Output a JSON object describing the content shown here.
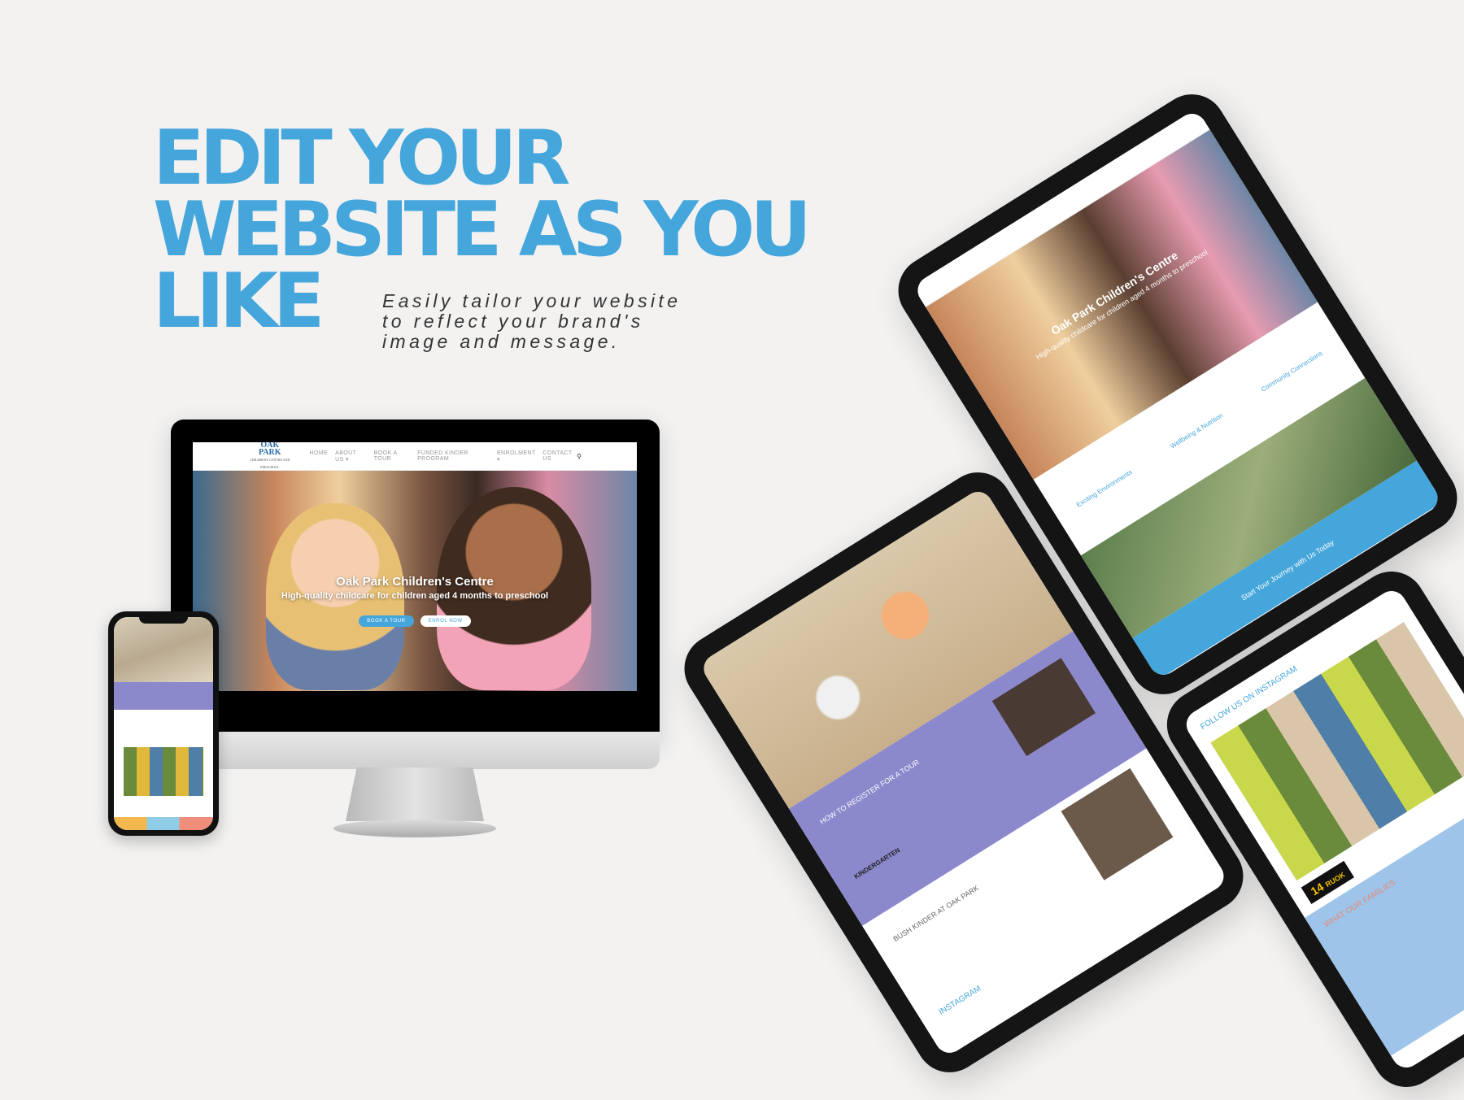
{
  "headline": {
    "line1": "EDIT YOUR",
    "line2": "WEBSITE AS YOU",
    "line3": "LIKE"
  },
  "tagline": {
    "line1": "Easily tailor your website",
    "line2": "to reflect your brand's",
    "line3": "image and message."
  },
  "desktop": {
    "logo": {
      "name": "OAK PARK",
      "sub": "CHILDREN'S CENTRE AND PRESCHOOL"
    },
    "nav": [
      "HOME",
      "ABOUT US ▾",
      "BOOK A TOUR",
      "FUNDED KINDER PROGRAM",
      "ENROLMENT ▾",
      "CONTACT US"
    ],
    "search_icon": "⚲",
    "hero": {
      "title": "Oak Park Children's Centre",
      "subtitle": "High-quality childcare for children aged 4 months to preschool",
      "btn_tour": "BOOK A TOUR",
      "btn_enrol": "ENROL NOW"
    }
  },
  "tablet_right": {
    "hero_title": "Oak Park Children's Centre",
    "hero_subtitle": "High-quality childcare for children aged 4 months to preschool",
    "features": [
      "Exciting Environments",
      "Wellbeing & Nutrition",
      "Community Connections"
    ],
    "cta": "Start Your Journey with Us Today"
  },
  "tablet_middle": {
    "tour_heading": "HOW TO REGISTER FOR A TOUR",
    "kinder_label": "KINDERGARTEN",
    "bush_heading": "BUSH KINDER AT OAK PARK",
    "insta_heading": "INSTAGRAM"
  },
  "tablet_bottom_right": {
    "follow_heading": "FOLLOW US ON INSTAGRAM",
    "families_heading": "WHAT OUR FAMILIES",
    "badge_number": "14",
    "badge_sub": "RUOK"
  },
  "colors": {
    "brand_blue": "#45a6dc",
    "lavender": "#8b88cc",
    "tablet_frame": "#151515"
  }
}
